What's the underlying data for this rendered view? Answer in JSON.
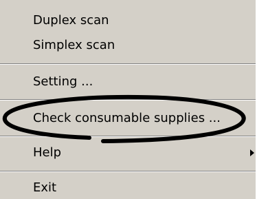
{
  "menu": {
    "items": [
      {
        "label": "Duplex scan"
      },
      {
        "label": "Simplex scan"
      },
      {
        "label": "Setting ..."
      },
      {
        "label": "Check consumable supplies ..."
      },
      {
        "label": "Help"
      },
      {
        "label": "Exit"
      }
    ]
  },
  "colors": {
    "menu_background": "#d4d0c8",
    "separator_dark": "#808080",
    "separator_light": "#ffffff",
    "annotation_stroke": "#000000"
  },
  "icons": {
    "submenu": "chevron-right-icon"
  }
}
